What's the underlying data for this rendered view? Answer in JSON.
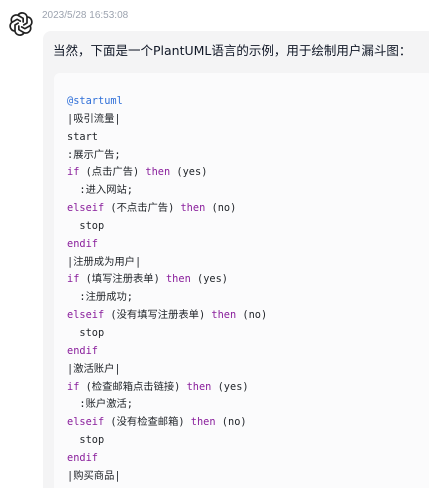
{
  "message": {
    "timestamp": "2023/5/28 16:53:08",
    "intro": "当然，下面是一个PlantUML语言的示例，用于绘制用户漏斗图：",
    "avatar_icon": "chatgpt-logo-icon"
  },
  "code_block": {
    "language": "plantuml",
    "colors": {
      "directive": "#2f6fd8",
      "keyword": "#8a1f9c",
      "text": "#1f2328"
    },
    "lines": [
      [
        {
          "t": "directive",
          "v": "@startuml"
        }
      ],
      [
        {
          "t": "plain",
          "v": "|吸引流量|"
        }
      ],
      [
        {
          "t": "plain",
          "v": "start"
        }
      ],
      [
        {
          "t": "plain",
          "v": ":展示广告;"
        }
      ],
      [
        {
          "t": "kw",
          "v": "if"
        },
        {
          "t": "plain",
          "v": " (点击广告) "
        },
        {
          "t": "kw",
          "v": "then"
        },
        {
          "t": "plain",
          "v": " (yes)"
        }
      ],
      [
        {
          "t": "plain",
          "v": "  :进入网站;"
        }
      ],
      [
        {
          "t": "kw",
          "v": "elseif"
        },
        {
          "t": "plain",
          "v": " (不点击广告) "
        },
        {
          "t": "kw",
          "v": "then"
        },
        {
          "t": "plain",
          "v": " (no)"
        }
      ],
      [
        {
          "t": "plain",
          "v": "  stop"
        }
      ],
      [
        {
          "t": "kw",
          "v": "endif"
        }
      ],
      [
        {
          "t": "plain",
          "v": "|注册成为用户|"
        }
      ],
      [
        {
          "t": "kw",
          "v": "if"
        },
        {
          "t": "plain",
          "v": " (填写注册表单) "
        },
        {
          "t": "kw",
          "v": "then"
        },
        {
          "t": "plain",
          "v": " (yes)"
        }
      ],
      [
        {
          "t": "plain",
          "v": "  :注册成功;"
        }
      ],
      [
        {
          "t": "kw",
          "v": "elseif"
        },
        {
          "t": "plain",
          "v": " (没有填写注册表单) "
        },
        {
          "t": "kw",
          "v": "then"
        },
        {
          "t": "plain",
          "v": " (no)"
        }
      ],
      [
        {
          "t": "plain",
          "v": "  stop"
        }
      ],
      [
        {
          "t": "kw",
          "v": "endif"
        }
      ],
      [
        {
          "t": "plain",
          "v": "|激活账户|"
        }
      ],
      [
        {
          "t": "kw",
          "v": "if"
        },
        {
          "t": "plain",
          "v": " (检查邮箱点击链接) "
        },
        {
          "t": "kw",
          "v": "then"
        },
        {
          "t": "plain",
          "v": " (yes)"
        }
      ],
      [
        {
          "t": "plain",
          "v": "  :账户激活;"
        }
      ],
      [
        {
          "t": "kw",
          "v": "elseif"
        },
        {
          "t": "plain",
          "v": " (没有检查邮箱) "
        },
        {
          "t": "kw",
          "v": "then"
        },
        {
          "t": "plain",
          "v": " (no)"
        }
      ],
      [
        {
          "t": "plain",
          "v": "  stop"
        }
      ],
      [
        {
          "t": "kw",
          "v": "endif"
        }
      ],
      [
        {
          "t": "plain",
          "v": "|购买商品|"
        }
      ]
    ]
  }
}
